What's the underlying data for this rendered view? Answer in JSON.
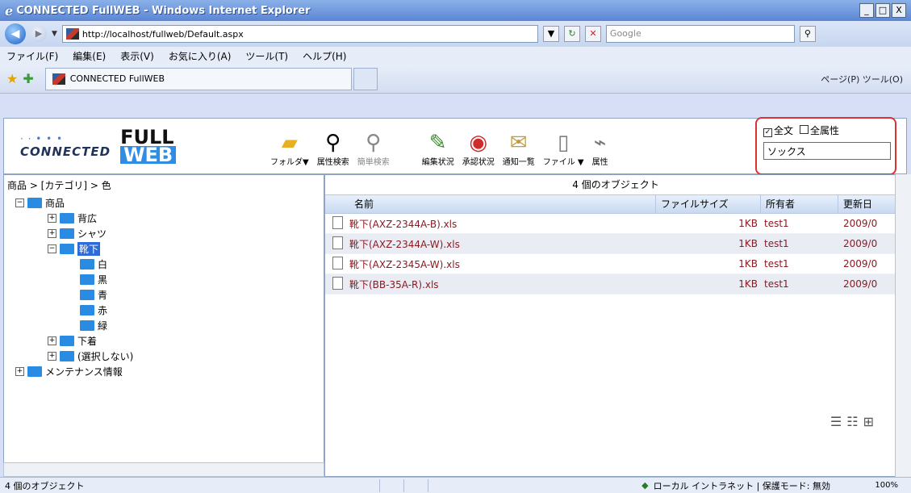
{
  "window": {
    "title": "CONNECTED FullWEB - Windows Internet Explorer",
    "min": "_",
    "max": "□",
    "close": "X"
  },
  "addressbar": {
    "url": "http://localhost/fullweb/Default.aspx",
    "search_placeholder": "Google"
  },
  "menu": [
    "ファイル(F)",
    "編集(E)",
    "表示(V)",
    "お気に入り(A)",
    "ツール(T)",
    "ヘルプ(H)"
  ],
  "tab": {
    "label": "CONNECTED FullWEB"
  },
  "commandbar": {
    "label": "ページ(P)  ツール(O)"
  },
  "app": {
    "logo_connected": "CONNECTED",
    "logo_full": "FULL",
    "logo_web": "WEB",
    "toolbar": [
      {
        "label": "フォルダ▼",
        "icon": "folder-icon"
      },
      {
        "label": "属性検索",
        "icon": "search-icon"
      },
      {
        "label": "簡単検索",
        "icon": "search-icon"
      },
      {
        "label": "編集状況",
        "icon": "pencil-icon"
      },
      {
        "label": "承認状況",
        "icon": "stamp-icon"
      },
      {
        "label": "通知一覧",
        "icon": "envelope-icon"
      },
      {
        "label": "ファイル ▼",
        "icon": "file-icon"
      },
      {
        "label": "属性",
        "icon": "tag-icon"
      }
    ],
    "search": {
      "fulltext_label": "全文",
      "fulltext_checked": true,
      "allattr_label": "全属性",
      "allattr_checked": false,
      "value": "ソックス"
    }
  },
  "tree": {
    "breadcrumb": "商品 > [カテゴリ] > 色",
    "nodes": [
      {
        "label": "商品",
        "level": 0,
        "exp": "⊟"
      },
      {
        "label": "背広",
        "level": 1,
        "exp": "⊞"
      },
      {
        "label": "シャツ",
        "level": 1,
        "exp": "⊞"
      },
      {
        "label": "靴下",
        "level": 1,
        "exp": "⊟",
        "selected": true
      },
      {
        "label": "白",
        "level": 2
      },
      {
        "label": "黒",
        "level": 2
      },
      {
        "label": "青",
        "level": 2
      },
      {
        "label": "赤",
        "level": 2
      },
      {
        "label": "緑",
        "level": 2
      },
      {
        "label": "下着",
        "level": 1,
        "exp": "⊞"
      },
      {
        "label": "(選択しない)",
        "level": 1,
        "exp": "⊞"
      },
      {
        "label": "メンテナンス情報",
        "level": 0,
        "exp": "⊞"
      }
    ]
  },
  "files": {
    "count_label": "4 個のオブジェクト",
    "columns": [
      "名前",
      "ファイルサイズ",
      "所有者",
      "更新日"
    ],
    "rows": [
      {
        "name": "靴下(AXZ-2344A-B).xls",
        "size": "1KB",
        "owner": "test1",
        "date": "2009/0"
      },
      {
        "name": "靴下(AXZ-2344A-W).xls",
        "size": "1KB",
        "owner": "test1",
        "date": "2009/0"
      },
      {
        "name": "靴下(AXZ-2345A-W).xls",
        "size": "1KB",
        "owner": "test1",
        "date": "2009/0"
      },
      {
        "name": "靴下(BB-35A-R).xls",
        "size": "1KB",
        "owner": "test1",
        "date": "2009/0"
      }
    ]
  },
  "status": {
    "left": "4 個のオブジェクト",
    "zone": "ローカル イントラネット | 保護モード: 無効",
    "zoom": "100%"
  }
}
